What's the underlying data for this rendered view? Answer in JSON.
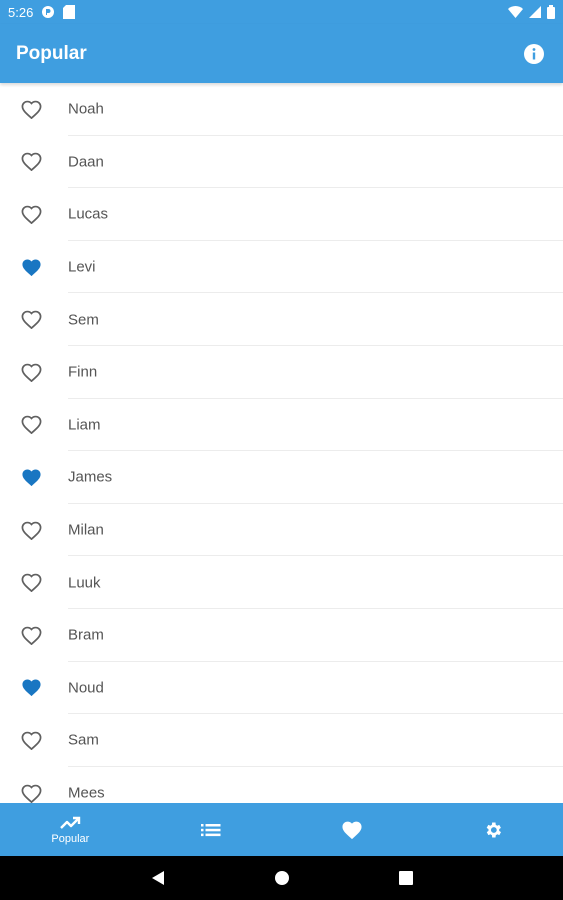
{
  "status_bar": {
    "time": "5:26"
  },
  "app_bar": {
    "title": "Popular"
  },
  "colors": {
    "primary": "#3f9ee0",
    "heart_filled": "#1976c2",
    "heart_outline": "#606060"
  },
  "names": [
    {
      "label": "Noah",
      "favorite": false
    },
    {
      "label": "Daan",
      "favorite": false
    },
    {
      "label": "Lucas",
      "favorite": false
    },
    {
      "label": "Levi",
      "favorite": true
    },
    {
      "label": "Sem",
      "favorite": false
    },
    {
      "label": "Finn",
      "favorite": false
    },
    {
      "label": "Liam",
      "favorite": false
    },
    {
      "label": "James",
      "favorite": true
    },
    {
      "label": "Milan",
      "favorite": false
    },
    {
      "label": "Luuk",
      "favorite": false
    },
    {
      "label": "Bram",
      "favorite": false
    },
    {
      "label": "Noud",
      "favorite": true
    },
    {
      "label": "Sam",
      "favorite": false
    },
    {
      "label": "Mees",
      "favorite": false
    }
  ],
  "bottom_nav": {
    "popular_label": "Popular",
    "items": [
      {
        "icon": "trending-up-icon",
        "active": true
      },
      {
        "icon": "list-icon",
        "active": false
      },
      {
        "icon": "heart-icon",
        "active": false
      },
      {
        "icon": "gear-icon",
        "active": false
      }
    ]
  }
}
